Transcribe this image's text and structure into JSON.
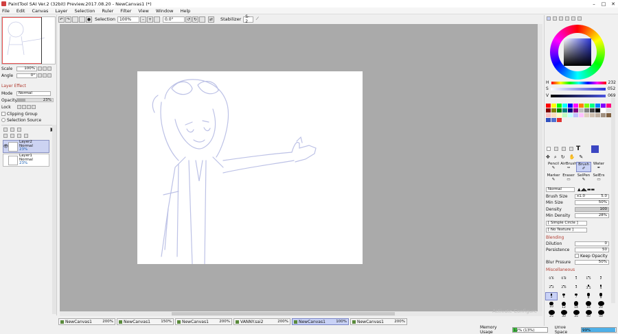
{
  "window": {
    "title": "PaintTool SAI Ver.2 (32bit) Preview.2017.08.20 - NewCanvas1 (*)"
  },
  "menu": [
    "File",
    "Edit",
    "Canvas",
    "Layer",
    "Selection",
    "Ruler",
    "Filter",
    "View",
    "Window",
    "Help"
  ],
  "toolbar": {
    "selection_label": "Selection",
    "zoom": "100%",
    "angle": "0.0°",
    "stabilizer_label": "Stabilizer",
    "stabilizer_value": "S-2"
  },
  "navigator": {
    "scale_label": "Scale",
    "scale_value": "100%",
    "angle_label": "Angle",
    "angle_value": "0°"
  },
  "layer_panel": {
    "effect_header": "Layer Effect",
    "mode_label": "Mode",
    "mode_value": "Normal",
    "opacity_label": "Opacity",
    "opacity_value": "23%",
    "opacity_fraction": 0.23,
    "lock_label": "Lock",
    "clipping_label": "Clipping Group",
    "selsource_label": "Selection Source",
    "layers": [
      {
        "name": "Layer2",
        "mode": "Normal",
        "opacity": "23%"
      },
      {
        "name": "Layer1",
        "mode": "Normal",
        "opacity": "23%"
      }
    ]
  },
  "tabs": [
    {
      "name": "NewCanvas1",
      "zoom": "200%"
    },
    {
      "name": "NewCanvas1",
      "zoom": "150%"
    },
    {
      "name": "NewCanvas1",
      "zoom": "200%"
    },
    {
      "name": "VANNY.sai2",
      "zoom": "200%"
    },
    {
      "name": "NewCanvas1",
      "zoom": "100%"
    },
    {
      "name": "NewCanvas1",
      "zoom": "200%"
    }
  ],
  "canvas_ghost_text": "Activate Configure",
  "status": {
    "memory_label": "Memory Usage",
    "memory_value": "12% (13%)",
    "memory_fraction": 0.12,
    "drive_label": "Drive Space",
    "drive_value": "99%",
    "drive_fraction": 0.99
  },
  "color": {
    "h_label": "H",
    "h_value": "232",
    "s_label": "S",
    "s_value": "052",
    "v_label": "V",
    "v_value": "069",
    "current": "#3b46c2"
  },
  "palette": [
    "#ff0000",
    "#ffff00",
    "#00ff00",
    "#00ffff",
    "#0000ff",
    "#ff00ff",
    "#ff8000",
    "#80ff00",
    "#00ff80",
    "#0080ff",
    "#8000ff",
    "#ff0080",
    "#800000",
    "#808000",
    "#008000",
    "#008080",
    "#000080",
    "#800080",
    "#c0c0c0",
    "#808080",
    "#404040",
    "#000000",
    "#ffffff",
    "#e0e0e0",
    "#ffc0c0",
    "#ffe0c0",
    "#ffffc0",
    "#c0ffc0",
    "#c0ffff",
    "#c0c0ff",
    "#ffc0ff",
    "#e0d0c0",
    "#d0c0b0",
    "#c0b0a0",
    "#a09080",
    "#806040",
    "#3050c0",
    "#5070d0",
    "#e03030"
  ],
  "tools": {
    "row1": [
      "Pencil",
      "AirBrush",
      "Brush",
      "Water"
    ],
    "row2": [
      "Marker",
      "Eraser",
      "SelPen",
      "SelErs"
    ],
    "selected": "Brush"
  },
  "brush_mode": "Normal",
  "brush_props": {
    "size_label": "Brush Size",
    "size_mult": "x1.0",
    "size_value": "5.0",
    "minsize_label": "Min Size",
    "minsize_value": "50%",
    "density_label": "Density",
    "density_value": "100",
    "mindensity_label": "Min Density",
    "mindensity_value": "28%",
    "circle": "[ Simple Circle ]",
    "texture": "[ No Texture ]"
  },
  "blending": {
    "header": "Blending",
    "dilution_label": "Dilution",
    "dilution_value": "0",
    "persistence_label": "Persistence",
    "persistence_value": "50",
    "keep_label": "Keep Opacity",
    "blur_label": "Blur Prssure",
    "blur_value": "50%"
  },
  "misc_header": "Miscellaneous",
  "brush_sizes": [
    "0.6",
    "0.8",
    "1",
    "1.5",
    "2",
    "2.3",
    "2.6",
    "3",
    "3.5",
    "4",
    "5",
    "6",
    "7",
    "8",
    "9",
    "10",
    "12",
    "14",
    "16",
    "20",
    "25",
    "30",
    "35",
    "40",
    "50"
  ]
}
